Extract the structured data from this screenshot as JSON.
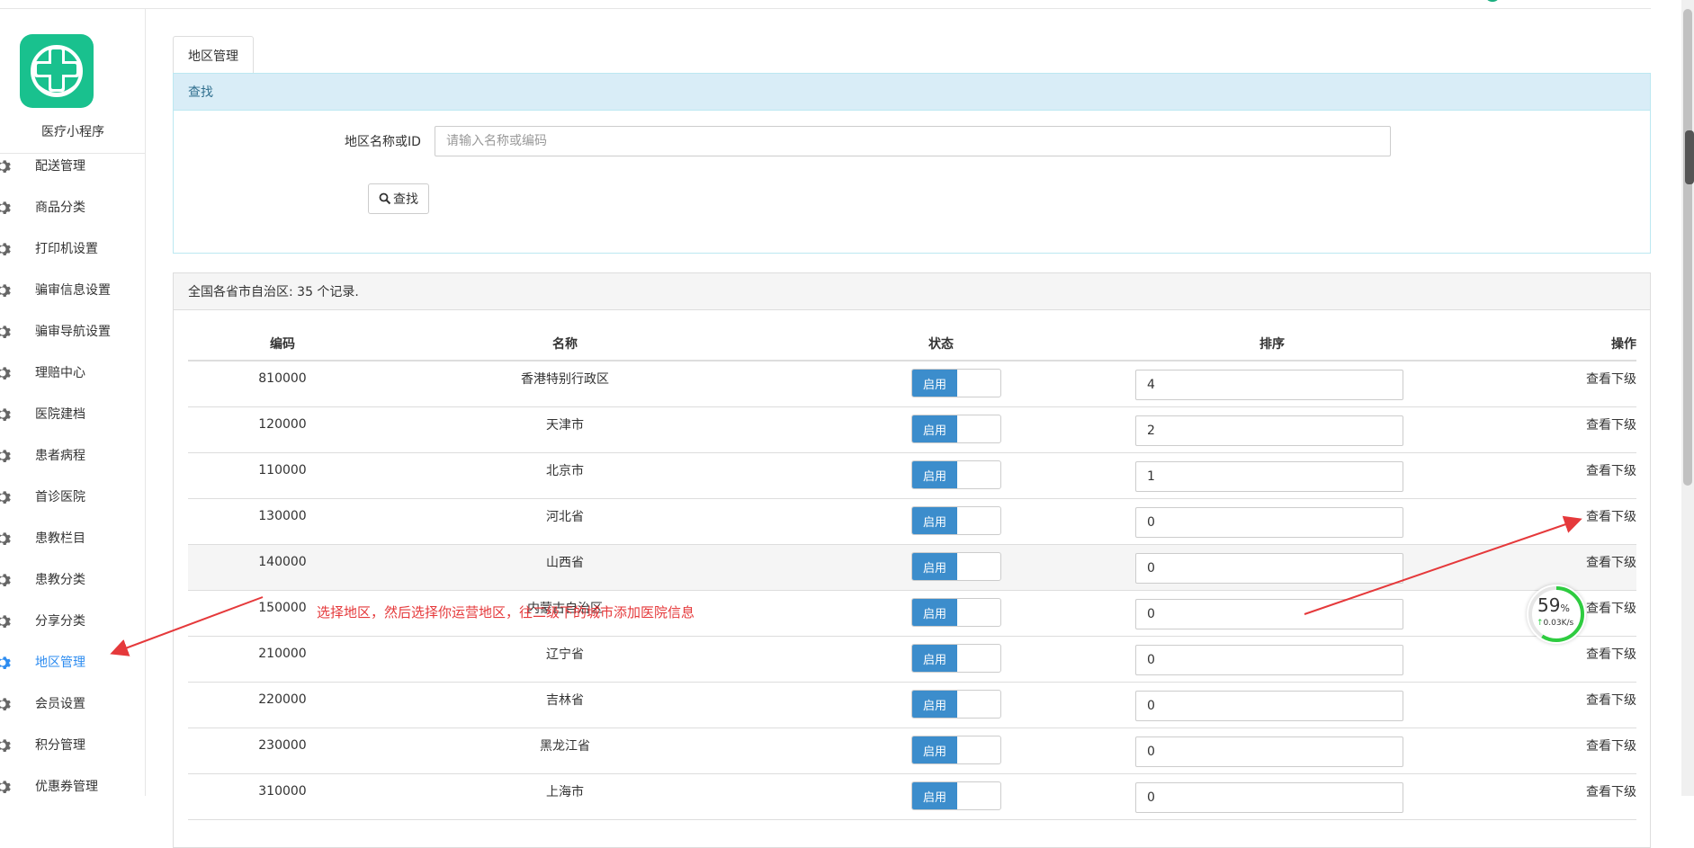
{
  "app": {
    "name": "医疗小程序"
  },
  "sidebar": {
    "items": [
      {
        "label": "配送管理",
        "active": false
      },
      {
        "label": "商品分类",
        "active": false
      },
      {
        "label": "打印机设置",
        "active": false
      },
      {
        "label": "骗审信息设置",
        "active": false
      },
      {
        "label": "骗审导航设置",
        "active": false
      },
      {
        "label": "理赔中心",
        "active": false
      },
      {
        "label": "医院建档",
        "active": false
      },
      {
        "label": "患者病程",
        "active": false
      },
      {
        "label": "首诊医院",
        "active": false
      },
      {
        "label": "患教栏目",
        "active": false
      },
      {
        "label": "患教分类",
        "active": false
      },
      {
        "label": "分享分类",
        "active": false
      },
      {
        "label": "地区管理",
        "active": true
      },
      {
        "label": "会员设置",
        "active": false
      },
      {
        "label": "积分管理",
        "active": false
      },
      {
        "label": "优惠券管理",
        "active": false
      }
    ]
  },
  "tab": {
    "label": "地区管理"
  },
  "search": {
    "panel_title": "查找",
    "field_label": "地区名称或ID",
    "placeholder": "请输入名称或编码",
    "button_label": "查找"
  },
  "list": {
    "summary": "全国各省市自治区: 35 个记录.",
    "columns": {
      "code": "编码",
      "name": "名称",
      "status": "状态",
      "sort": "排序",
      "action": "操作"
    },
    "status_on_label": "启用",
    "action_label": "查看下级",
    "rows": [
      {
        "code": "810000",
        "name": "香港特别行政区",
        "sort": "4"
      },
      {
        "code": "120000",
        "name": "天津市",
        "sort": "2"
      },
      {
        "code": "110000",
        "name": "北京市",
        "sort": "1"
      },
      {
        "code": "130000",
        "name": "河北省",
        "sort": "0"
      },
      {
        "code": "140000",
        "name": "山西省",
        "sort": "0"
      },
      {
        "code": "150000",
        "name": "内蒙古自治区",
        "sort": "0"
      },
      {
        "code": "210000",
        "name": "辽宁省",
        "sort": "0"
      },
      {
        "code": "220000",
        "name": "吉林省",
        "sort": "0"
      },
      {
        "code": "230000",
        "name": "黑龙江省",
        "sort": "0"
      },
      {
        "code": "310000",
        "name": "上海市",
        "sort": "0"
      }
    ]
  },
  "annotation": {
    "text": "选择地区，然后选择你运营地区，往二级下的城市添加医院信息",
    "color": "#e5393b"
  },
  "speed_widget": {
    "percent": "59",
    "percent_unit": "%",
    "rate": "0.03K/s"
  },
  "colors": {
    "accent": "#2d8cf0",
    "toggle_on": "#3c8dcc",
    "logo": "#19c18e",
    "panel_head": "#d9edf7"
  }
}
